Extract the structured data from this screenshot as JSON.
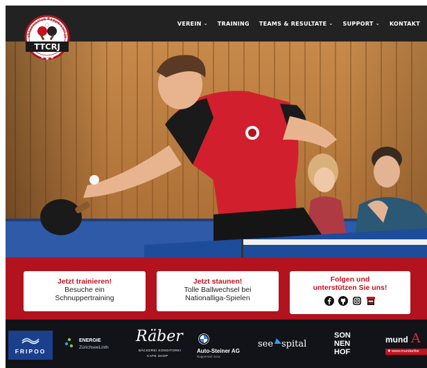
{
  "header": {
    "logo": {
      "text": "TTCRJ",
      "ring_text": "Tischtennisclub Rapperswil-Jona"
    },
    "nav": [
      {
        "label": "VEREIN",
        "dropdown": true
      },
      {
        "label": "TRAINING",
        "dropdown": false
      },
      {
        "label": "TEAMS & RESULTATE",
        "dropdown": true
      },
      {
        "label": "SUPPORT",
        "dropdown": true
      },
      {
        "label": "KONTAKT",
        "dropdown": false
      }
    ]
  },
  "hero": {
    "image": "table-tennis-player-action-photo"
  },
  "cards": [
    {
      "title": "Jetzt trainieren!",
      "line1": "Besuche ein",
      "line2": "Schnuppertraining"
    },
    {
      "title": "Jetzt staunen!",
      "line1": "Tolle Ballwechsel bei",
      "line2": "Nationalliga-Spielen"
    },
    {
      "title_line1": "Folgen und",
      "title_line2": "unterstützen Sie uns!",
      "icons": [
        "facebook-icon",
        "github-icon",
        "instagram-icon",
        "store-icon"
      ]
    }
  ],
  "sponsors": {
    "fripoo": "FRIPOO",
    "energie": {
      "line1": "ENERGIE",
      "line2": "ZürichseeLinth"
    },
    "raber": {
      "main": "Räber",
      "sub1": "BÄCKEREI KONDITOREI",
      "sub2": "CAFE SHOP"
    },
    "autosteiner": {
      "name": "Auto-Steiner AG",
      "sub": "Rapperswil-Jona"
    },
    "seespital": {
      "see": "see",
      "spital": "spital"
    },
    "sonnenhof": [
      "SON",
      "NEN",
      "HOF"
    ],
    "mundart": {
      "name": "mund",
      "accent": "A",
      "url": "www.mundartbe"
    }
  },
  "colors": {
    "brand_red": "#c4121f",
    "band_red": "#b2131f",
    "dark": "#222222",
    "sponsor_bg": "#111318"
  }
}
